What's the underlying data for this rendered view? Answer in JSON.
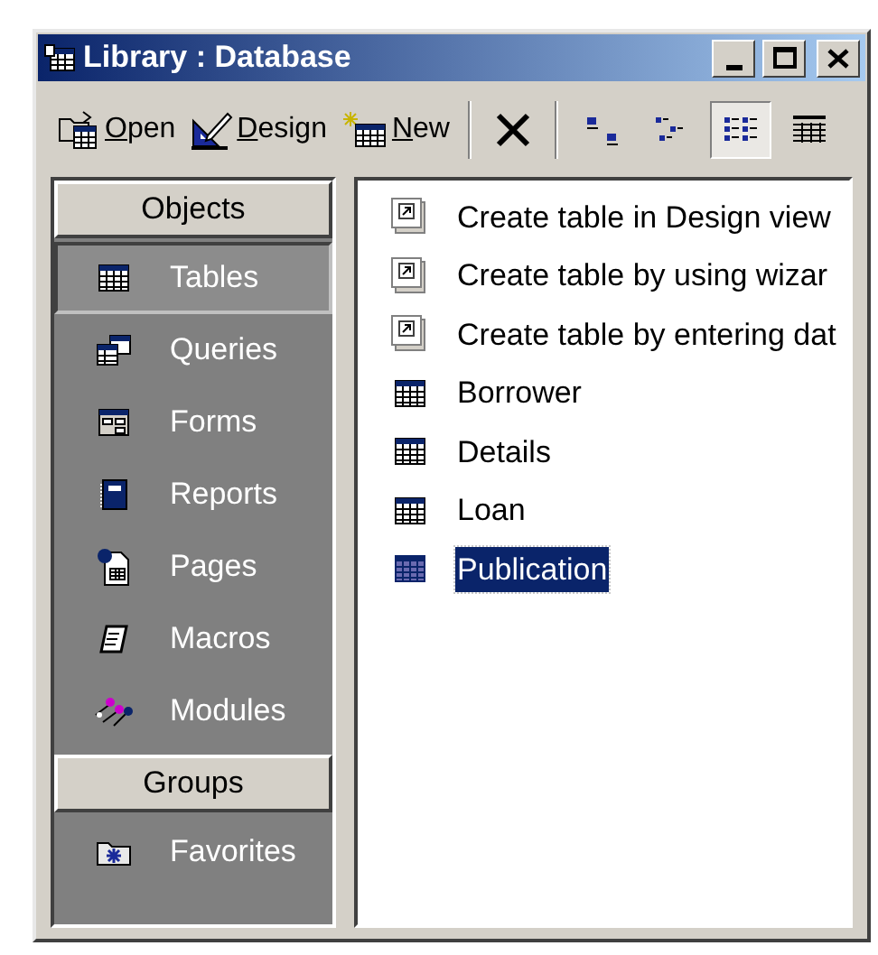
{
  "window": {
    "title": "Library : Database"
  },
  "toolbar": {
    "actions": [
      {
        "kind": "open",
        "label": "Open"
      },
      {
        "kind": "design",
        "label": "Design"
      },
      {
        "kind": "new",
        "label": "New"
      }
    ],
    "views": [
      {
        "kind": "large",
        "selected": false
      },
      {
        "kind": "small",
        "selected": false
      },
      {
        "kind": "list",
        "selected": true
      },
      {
        "kind": "details",
        "selected": false
      }
    ]
  },
  "sidebar": {
    "sections": [
      {
        "header": "Objects",
        "items": [
          {
            "kind": "tables",
            "label": "Tables",
            "selected": true
          },
          {
            "kind": "queries",
            "label": "Queries",
            "selected": false
          },
          {
            "kind": "forms",
            "label": "Forms",
            "selected": false
          },
          {
            "kind": "reports",
            "label": "Reports",
            "selected": false
          },
          {
            "kind": "pages",
            "label": "Pages",
            "selected": false
          },
          {
            "kind": "macros",
            "label": "Macros",
            "selected": false
          },
          {
            "kind": "modules",
            "label": "Modules",
            "selected": false
          }
        ]
      },
      {
        "header": "Groups",
        "items": [
          {
            "kind": "favorites",
            "label": "Favorites",
            "selected": false
          }
        ]
      }
    ]
  },
  "list": {
    "items": [
      {
        "kind": "shortcut",
        "label": "Create table in Design view",
        "selected": false
      },
      {
        "kind": "shortcut",
        "label": "Create table by using wizar",
        "selected": false
      },
      {
        "kind": "shortcut",
        "label": "Create table by entering dat",
        "selected": false
      },
      {
        "kind": "table",
        "label": "Borrower",
        "selected": false
      },
      {
        "kind": "table",
        "label": "Details",
        "selected": false
      },
      {
        "kind": "table",
        "label": "Loan",
        "selected": false
      },
      {
        "kind": "table",
        "label": "Publication",
        "selected": true
      }
    ]
  }
}
